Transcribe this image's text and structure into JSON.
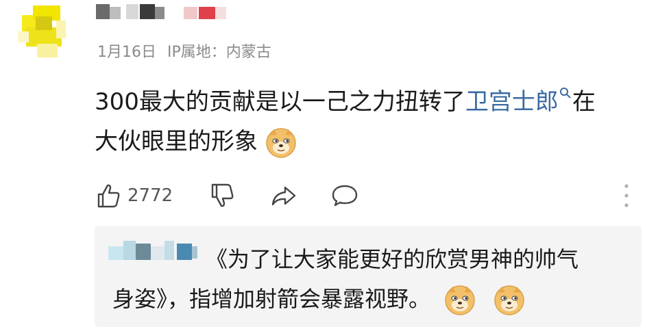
{
  "comment": {
    "date": "1月16日",
    "ip_location_label": "IP属地：",
    "ip_location_value": "内蒙古",
    "text_part1": "300最大的贡献是以一己之力扭转了",
    "link_text": "卫宫士郎",
    "text_part2": "在",
    "text_line2": "大伙眼里的形象"
  },
  "actions": {
    "like_count": "2772"
  },
  "reply": {
    "text_line1": "《为了让大家能更好的欣赏男神的帅气",
    "text_line2": "身姿》，指增加射箭会暴露视野。"
  },
  "colors": {
    "link": "#3a6aa2",
    "meta_text": "#8a8a8a",
    "reply_bg": "#f4f4f4",
    "avatar_mosaic": "#f2e600"
  },
  "icons": [
    "thumbs-up-icon",
    "thumbs-down-icon",
    "share-icon",
    "comment-bubble-icon",
    "more-vertical-icon",
    "search-icon",
    "doge-emoji-icon"
  ]
}
